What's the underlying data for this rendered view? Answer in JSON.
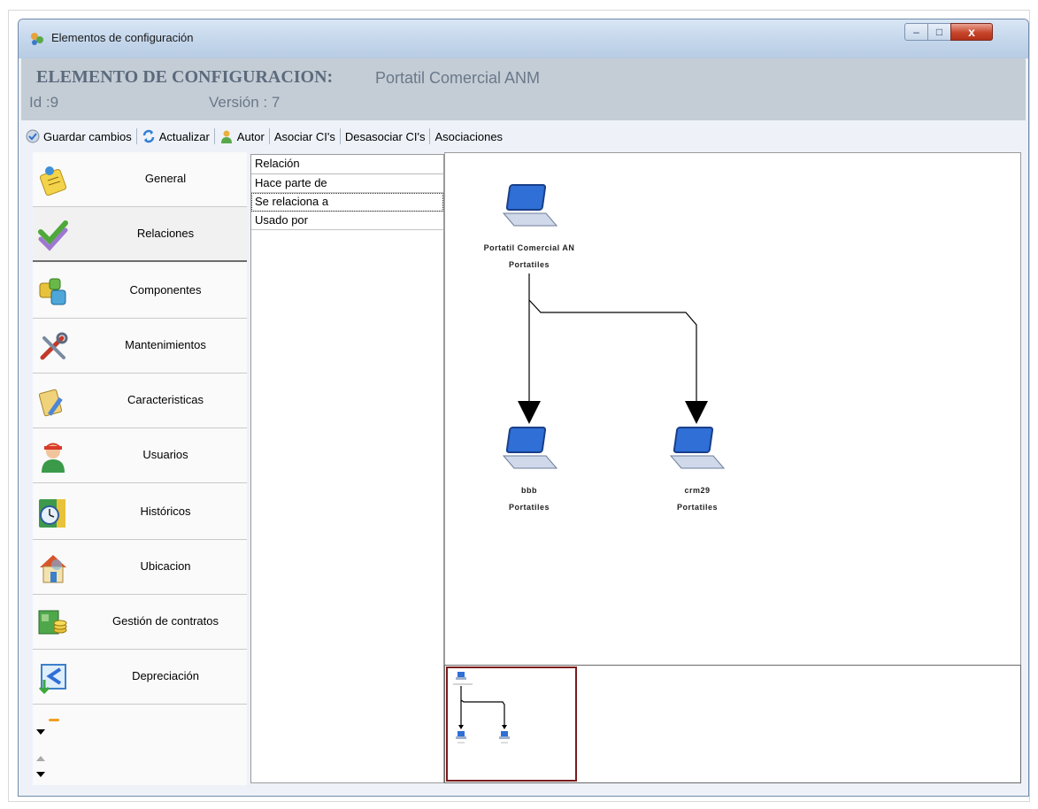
{
  "window": {
    "title": "Elementos de configuración",
    "controls": {
      "minimize": "–",
      "maximize": "□",
      "close": "x"
    }
  },
  "header": {
    "label": "ELEMENTO DE CONFIGURACION:",
    "name": "Portatil Comercial ANM",
    "id_text": "Id :9",
    "version_text": "Versión : 7"
  },
  "toolbar": {
    "save": "Guardar cambios",
    "refresh": "Actualizar",
    "author": "Autor",
    "associate": "Asociar CI's",
    "disassociate": "Desasociar CI's",
    "associations": "Asociaciones"
  },
  "nav": {
    "items": [
      {
        "label": "General",
        "icon": "notepad-icon"
      },
      {
        "label": "Relaciones",
        "icon": "checkmark-icon",
        "active": true
      },
      {
        "label": "Componentes",
        "icon": "puzzle-icon"
      },
      {
        "label": "Mantenimientos",
        "icon": "tools-icon"
      },
      {
        "label": "Caracteristicas",
        "icon": "clipboard-pencil-icon"
      },
      {
        "label": "Usuarios",
        "icon": "user-icon"
      },
      {
        "label": "Históricos",
        "icon": "clock-icon"
      },
      {
        "label": "Ubicacion",
        "icon": "house-icon"
      },
      {
        "label": "Gestión de contratos",
        "icon": "money-icon"
      },
      {
        "label": "Depreciación",
        "icon": "depreciation-icon"
      }
    ]
  },
  "relations": {
    "header": "Relación",
    "rows": [
      "Hace parte de",
      "Se relaciona a",
      "Usado por"
    ],
    "selected_index": 1
  },
  "graph": {
    "nodes": [
      {
        "name": "Portatil Comercial AN",
        "type": "Portatiles"
      },
      {
        "name": "bbb",
        "type": "Portatiles"
      },
      {
        "name": "crm29",
        "type": "Portatiles"
      }
    ]
  },
  "colors": {
    "header_bg": "#c4cdd6",
    "header_text": "#5b6a7c",
    "laptop_blue": "#2f6fd6",
    "minimap_border": "#7a1b1b"
  }
}
